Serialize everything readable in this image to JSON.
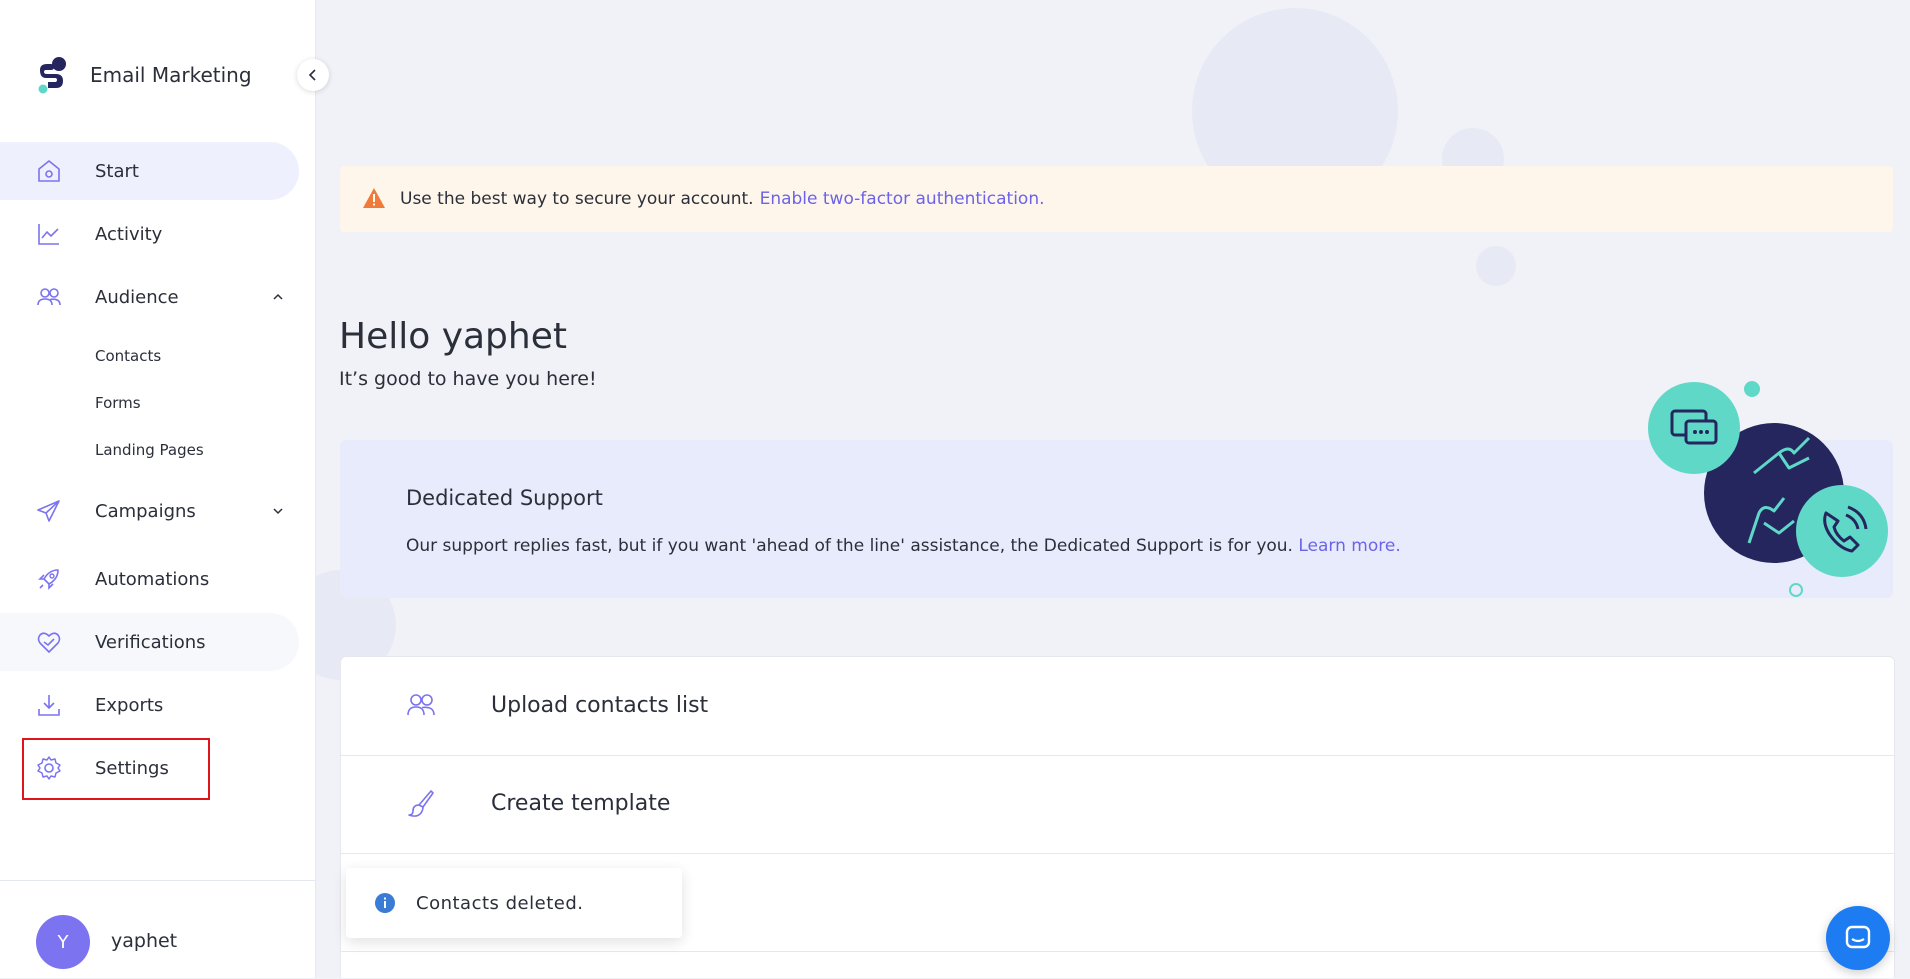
{
  "brand": {
    "name": "Email Marketing",
    "logo_icon": "brand-logo"
  },
  "sidebar": {
    "items": [
      {
        "label": "Start",
        "icon": "home-icon"
      },
      {
        "label": "Activity",
        "icon": "chart-icon"
      },
      {
        "label": "Audience",
        "icon": "users-icon"
      },
      {
        "label": "Campaigns",
        "icon": "paper-plane-icon"
      },
      {
        "label": "Automations",
        "icon": "rocket-icon"
      },
      {
        "label": "Verifications",
        "icon": "heart-check-icon"
      },
      {
        "label": "Exports",
        "icon": "download-icon"
      },
      {
        "label": "Settings",
        "icon": "gear-icon"
      }
    ],
    "audience_sub": [
      "Contacts",
      "Forms",
      "Landing Pages"
    ]
  },
  "user": {
    "initial": "Y",
    "name": "yaphet"
  },
  "alert": {
    "text": "Use the best way to secure your account.",
    "link": "Enable two-factor authentication."
  },
  "greeting": {
    "title": "Hello yaphet",
    "subtitle": "It’s good to have you here!"
  },
  "support": {
    "title": "Dedicated Support",
    "text": "Our support replies fast, but if you want 'ahead of the line' assistance, the Dedicated Support is for you.",
    "link": "Learn more."
  },
  "actions": [
    {
      "label": "Upload contacts list",
      "icon": "users-icon"
    },
    {
      "label": "Create template",
      "icon": "brush-icon"
    },
    {
      "label": "",
      "icon": ""
    }
  ],
  "toast": {
    "text": "Contacts deleted."
  },
  "colors": {
    "accent": "#6c63e8",
    "warning": "#f07a3a",
    "teal": "#5fd8c8",
    "navy": "#25265e",
    "chat": "#1d7cf2",
    "highlight": "#e0141b"
  }
}
